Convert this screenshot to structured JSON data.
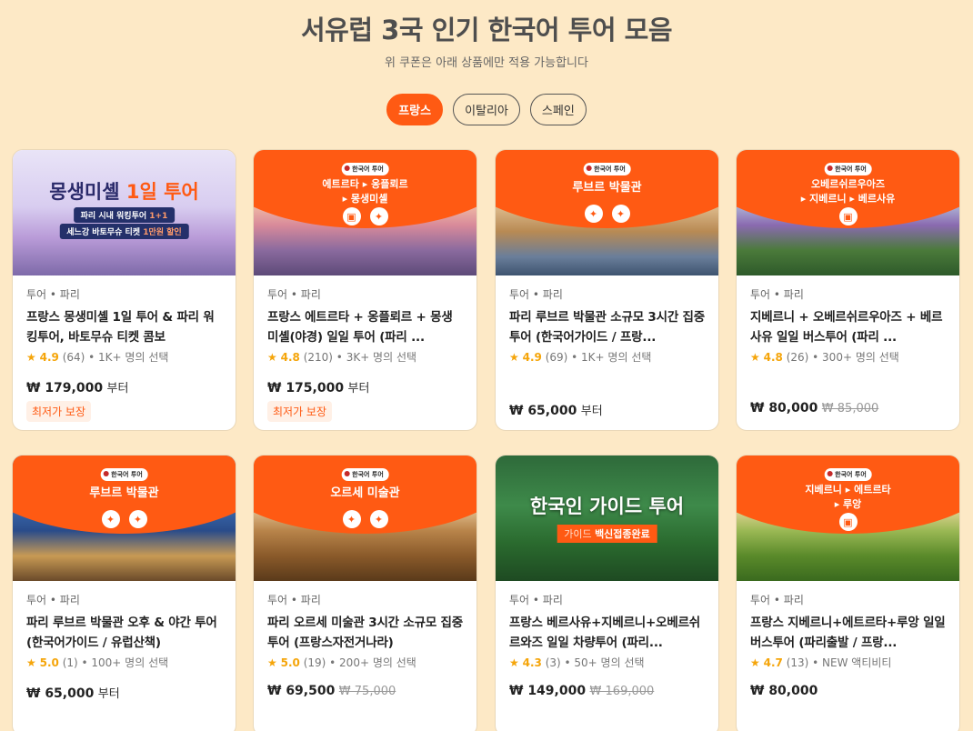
{
  "header": {
    "title": "서유럽 3국 인기 한국어 투어 모음",
    "subtitle": "위 쿠폰은 아래 상품에만 적용 가능합니다"
  },
  "tabs": [
    {
      "label": "프랑스",
      "active": true
    },
    {
      "label": "이탈리아",
      "active": false
    },
    {
      "label": "스페인",
      "active": false
    }
  ],
  "colors": {
    "accent": "#ff5a13",
    "background": "#fde9c6",
    "star": "#f5a50a"
  },
  "products": [
    {
      "meta": "투어 • 파리",
      "name": "프랑스 몽생미셸 1일 투어 & 파리 워킹투어, 바토무슈 티켓 콤보",
      "score": "4.9",
      "reviews": "(64)",
      "popularity": "1K+ 명의 선택",
      "price": "₩ 179,000",
      "original_price": "",
      "suffix": "부터",
      "badge": "최저가 보장",
      "banner": {
        "style": "purple",
        "headline_a": "몽생미셸 ",
        "headline_b": "1일 투어",
        "pill1_a": "파리 시내 워킹투어 ",
        "pill1_b": "1+1",
        "pill2_a": "세느강 바토무슈 티켓 ",
        "pill2_b": "1만원 할인"
      }
    },
    {
      "meta": "투어 • 파리",
      "name": "프랑스 에트르타 + 옹플뢰르 + 몽생미셸(야경) 일일 투어 (파리 ...",
      "score": "4.8",
      "reviews": "(210)",
      "popularity": "3K+ 명의 선택",
      "price": "₩ 175,000",
      "original_price": "",
      "suffix": "부터",
      "badge": "최저가 보장",
      "banner": {
        "style": "orange",
        "chip": "한국어 투어",
        "lines": [
          "에트르타 ▸ 옹플뢰르",
          "▸ 몽생미셸"
        ],
        "icons": [
          "bus-icon",
          "walking-icon"
        ]
      }
    },
    {
      "meta": "투어 • 파리",
      "name": "파리 루브르 박물관 소규모 3시간 집중투어 (한국어가이드 / 프랑...",
      "score": "4.9",
      "reviews": "(69)",
      "popularity": "1K+ 명의 선택",
      "price": "₩ 65,000",
      "original_price": "",
      "suffix": "부터",
      "badge": "",
      "banner": {
        "style": "orange",
        "chip": "한국어 투어",
        "lines": [
          "루브르 박물관"
        ],
        "icons": [
          "walking-icon",
          "walking-icon"
        ]
      }
    },
    {
      "meta": "투어 • 파리",
      "name": "지베르니 + 오베르쉬르우아즈 + 베르사유 일일 버스투어 (파리 ...",
      "score": "4.8",
      "reviews": "(26)",
      "popularity": "300+ 명의 선택",
      "price": "₩ 80,000",
      "original_price": "₩ 85,000",
      "suffix": "",
      "badge": "",
      "banner": {
        "style": "orange",
        "chip": "한국어 투어",
        "lines": [
          "오베르쉬르우아즈",
          "▸ 지베르니 ▸ 베르사유"
        ],
        "icons": [
          "bus-icon"
        ]
      }
    },
    {
      "meta": "투어 • 파리",
      "name": "파리 루브르 박물관 오후 & 야간 투어 (한국어가이드 / 유럽산책)",
      "score": "5.0",
      "reviews": "(1)",
      "popularity": "100+ 명의 선택",
      "price": "₩ 65,000",
      "original_price": "",
      "suffix": "부터",
      "badge": "",
      "banner": {
        "style": "orange",
        "chip": "한국어 투어",
        "lines": [
          "루브르 박물관"
        ],
        "icons": [
          "walking-icon",
          "walking-icon"
        ]
      }
    },
    {
      "meta": "투어 • 파리",
      "name": "파리 오르세 미술관 3시간 소규모 집중투어 (프랑스자전거나라)",
      "score": "5.0",
      "reviews": "(19)",
      "popularity": "200+ 명의 선택",
      "price": "₩ 69,500",
      "original_price": "₩ 75,000",
      "suffix": "",
      "badge": "",
      "banner": {
        "style": "orange",
        "chip": "한국어 투어",
        "lines": [
          "오르세 미술관"
        ],
        "icons": [
          "walking-icon",
          "walking-icon"
        ]
      }
    },
    {
      "meta": "투어 • 파리",
      "name": "프랑스 베르사유+지베르니+오베르쉬르와즈 일일 차량투어 (파리...",
      "score": "4.3",
      "reviews": "(3)",
      "popularity": "50+ 명의 선택",
      "price": "₩ 149,000",
      "original_price": "₩ 169,000",
      "suffix": "",
      "badge": "",
      "banner": {
        "style": "green",
        "headline": "한국인 가이드 투어",
        "pill_a": "가이드 ",
        "pill_b": "백신접종완료"
      }
    },
    {
      "meta": "투어 • 파리",
      "name": "프랑스 지베르니+에트르타+루앙 일일 버스투어 (파리출발 / 프랑...",
      "score": "4.7",
      "reviews": "(13)",
      "popularity": "NEW 액티비티",
      "price": "₩ 80,000",
      "original_price": "",
      "suffix": "",
      "badge": "",
      "banner": {
        "style": "orange",
        "chip": "한국어 투어",
        "lines": [
          "지베르니 ▸ 에트르타",
          "▸ 루앙"
        ],
        "icons": [
          "bus-icon"
        ]
      }
    }
  ]
}
